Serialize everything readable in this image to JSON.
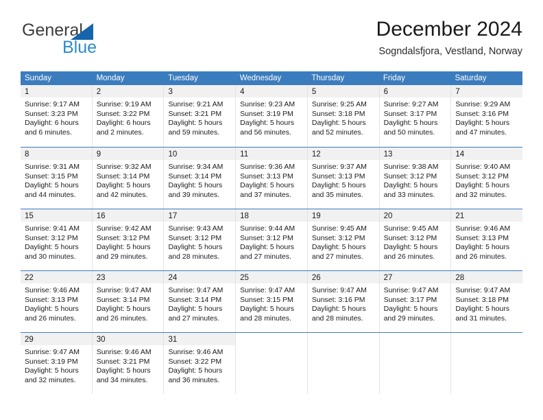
{
  "logo": {
    "word_top": "General",
    "word_bottom": "Blue",
    "triangle_color": "#1565ac",
    "blue_color": "#2b8ccc"
  },
  "header": {
    "title": "December 2024",
    "subtitle": "Sogndalsfjora, Vestland, Norway"
  },
  "theme": {
    "header_blue": "#3b7cbe",
    "daynum_band": "#f1f1f1",
    "cell_divider": "#e3e3e3"
  },
  "weekdays": [
    "Sunday",
    "Monday",
    "Tuesday",
    "Wednesday",
    "Thursday",
    "Friday",
    "Saturday"
  ],
  "weeks": [
    [
      {
        "day": "1",
        "sunrise": "Sunrise: 9:17 AM",
        "sunset": "Sunset: 3:23 PM",
        "daylight1": "Daylight: 6 hours",
        "daylight2": "and 6 minutes."
      },
      {
        "day": "2",
        "sunrise": "Sunrise: 9:19 AM",
        "sunset": "Sunset: 3:22 PM",
        "daylight1": "Daylight: 6 hours",
        "daylight2": "and 2 minutes."
      },
      {
        "day": "3",
        "sunrise": "Sunrise: 9:21 AM",
        "sunset": "Sunset: 3:21 PM",
        "daylight1": "Daylight: 5 hours",
        "daylight2": "and 59 minutes."
      },
      {
        "day": "4",
        "sunrise": "Sunrise: 9:23 AM",
        "sunset": "Sunset: 3:19 PM",
        "daylight1": "Daylight: 5 hours",
        "daylight2": "and 56 minutes."
      },
      {
        "day": "5",
        "sunrise": "Sunrise: 9:25 AM",
        "sunset": "Sunset: 3:18 PM",
        "daylight1": "Daylight: 5 hours",
        "daylight2": "and 52 minutes."
      },
      {
        "day": "6",
        "sunrise": "Sunrise: 9:27 AM",
        "sunset": "Sunset: 3:17 PM",
        "daylight1": "Daylight: 5 hours",
        "daylight2": "and 50 minutes."
      },
      {
        "day": "7",
        "sunrise": "Sunrise: 9:29 AM",
        "sunset": "Sunset: 3:16 PM",
        "daylight1": "Daylight: 5 hours",
        "daylight2": "and 47 minutes."
      }
    ],
    [
      {
        "day": "8",
        "sunrise": "Sunrise: 9:31 AM",
        "sunset": "Sunset: 3:15 PM",
        "daylight1": "Daylight: 5 hours",
        "daylight2": "and 44 minutes."
      },
      {
        "day": "9",
        "sunrise": "Sunrise: 9:32 AM",
        "sunset": "Sunset: 3:14 PM",
        "daylight1": "Daylight: 5 hours",
        "daylight2": "and 42 minutes."
      },
      {
        "day": "10",
        "sunrise": "Sunrise: 9:34 AM",
        "sunset": "Sunset: 3:14 PM",
        "daylight1": "Daylight: 5 hours",
        "daylight2": "and 39 minutes."
      },
      {
        "day": "11",
        "sunrise": "Sunrise: 9:36 AM",
        "sunset": "Sunset: 3:13 PM",
        "daylight1": "Daylight: 5 hours",
        "daylight2": "and 37 minutes."
      },
      {
        "day": "12",
        "sunrise": "Sunrise: 9:37 AM",
        "sunset": "Sunset: 3:13 PM",
        "daylight1": "Daylight: 5 hours",
        "daylight2": "and 35 minutes."
      },
      {
        "day": "13",
        "sunrise": "Sunrise: 9:38 AM",
        "sunset": "Sunset: 3:12 PM",
        "daylight1": "Daylight: 5 hours",
        "daylight2": "and 33 minutes."
      },
      {
        "day": "14",
        "sunrise": "Sunrise: 9:40 AM",
        "sunset": "Sunset: 3:12 PM",
        "daylight1": "Daylight: 5 hours",
        "daylight2": "and 32 minutes."
      }
    ],
    [
      {
        "day": "15",
        "sunrise": "Sunrise: 9:41 AM",
        "sunset": "Sunset: 3:12 PM",
        "daylight1": "Daylight: 5 hours",
        "daylight2": "and 30 minutes."
      },
      {
        "day": "16",
        "sunrise": "Sunrise: 9:42 AM",
        "sunset": "Sunset: 3:12 PM",
        "daylight1": "Daylight: 5 hours",
        "daylight2": "and 29 minutes."
      },
      {
        "day": "17",
        "sunrise": "Sunrise: 9:43 AM",
        "sunset": "Sunset: 3:12 PM",
        "daylight1": "Daylight: 5 hours",
        "daylight2": "and 28 minutes."
      },
      {
        "day": "18",
        "sunrise": "Sunrise: 9:44 AM",
        "sunset": "Sunset: 3:12 PM",
        "daylight1": "Daylight: 5 hours",
        "daylight2": "and 27 minutes."
      },
      {
        "day": "19",
        "sunrise": "Sunrise: 9:45 AM",
        "sunset": "Sunset: 3:12 PM",
        "daylight1": "Daylight: 5 hours",
        "daylight2": "and 27 minutes."
      },
      {
        "day": "20",
        "sunrise": "Sunrise: 9:45 AM",
        "sunset": "Sunset: 3:12 PM",
        "daylight1": "Daylight: 5 hours",
        "daylight2": "and 26 minutes."
      },
      {
        "day": "21",
        "sunrise": "Sunrise: 9:46 AM",
        "sunset": "Sunset: 3:13 PM",
        "daylight1": "Daylight: 5 hours",
        "daylight2": "and 26 minutes."
      }
    ],
    [
      {
        "day": "22",
        "sunrise": "Sunrise: 9:46 AM",
        "sunset": "Sunset: 3:13 PM",
        "daylight1": "Daylight: 5 hours",
        "daylight2": "and 26 minutes."
      },
      {
        "day": "23",
        "sunrise": "Sunrise: 9:47 AM",
        "sunset": "Sunset: 3:14 PM",
        "daylight1": "Daylight: 5 hours",
        "daylight2": "and 26 minutes."
      },
      {
        "day": "24",
        "sunrise": "Sunrise: 9:47 AM",
        "sunset": "Sunset: 3:14 PM",
        "daylight1": "Daylight: 5 hours",
        "daylight2": "and 27 minutes."
      },
      {
        "day": "25",
        "sunrise": "Sunrise: 9:47 AM",
        "sunset": "Sunset: 3:15 PM",
        "daylight1": "Daylight: 5 hours",
        "daylight2": "and 28 minutes."
      },
      {
        "day": "26",
        "sunrise": "Sunrise: 9:47 AM",
        "sunset": "Sunset: 3:16 PM",
        "daylight1": "Daylight: 5 hours",
        "daylight2": "and 28 minutes."
      },
      {
        "day": "27",
        "sunrise": "Sunrise: 9:47 AM",
        "sunset": "Sunset: 3:17 PM",
        "daylight1": "Daylight: 5 hours",
        "daylight2": "and 29 minutes."
      },
      {
        "day": "28",
        "sunrise": "Sunrise: 9:47 AM",
        "sunset": "Sunset: 3:18 PM",
        "daylight1": "Daylight: 5 hours",
        "daylight2": "and 31 minutes."
      }
    ],
    [
      {
        "day": "29",
        "sunrise": "Sunrise: 9:47 AM",
        "sunset": "Sunset: 3:19 PM",
        "daylight1": "Daylight: 5 hours",
        "daylight2": "and 32 minutes."
      },
      {
        "day": "30",
        "sunrise": "Sunrise: 9:46 AM",
        "sunset": "Sunset: 3:21 PM",
        "daylight1": "Daylight: 5 hours",
        "daylight2": "and 34 minutes."
      },
      {
        "day": "31",
        "sunrise": "Sunrise: 9:46 AM",
        "sunset": "Sunset: 3:22 PM",
        "daylight1": "Daylight: 5 hours",
        "daylight2": "and 36 minutes."
      },
      {
        "day": "",
        "sunrise": "",
        "sunset": "",
        "daylight1": "",
        "daylight2": ""
      },
      {
        "day": "",
        "sunrise": "",
        "sunset": "",
        "daylight1": "",
        "daylight2": ""
      },
      {
        "day": "",
        "sunrise": "",
        "sunset": "",
        "daylight1": "",
        "daylight2": ""
      },
      {
        "day": "",
        "sunrise": "",
        "sunset": "",
        "daylight1": "",
        "daylight2": ""
      }
    ]
  ]
}
